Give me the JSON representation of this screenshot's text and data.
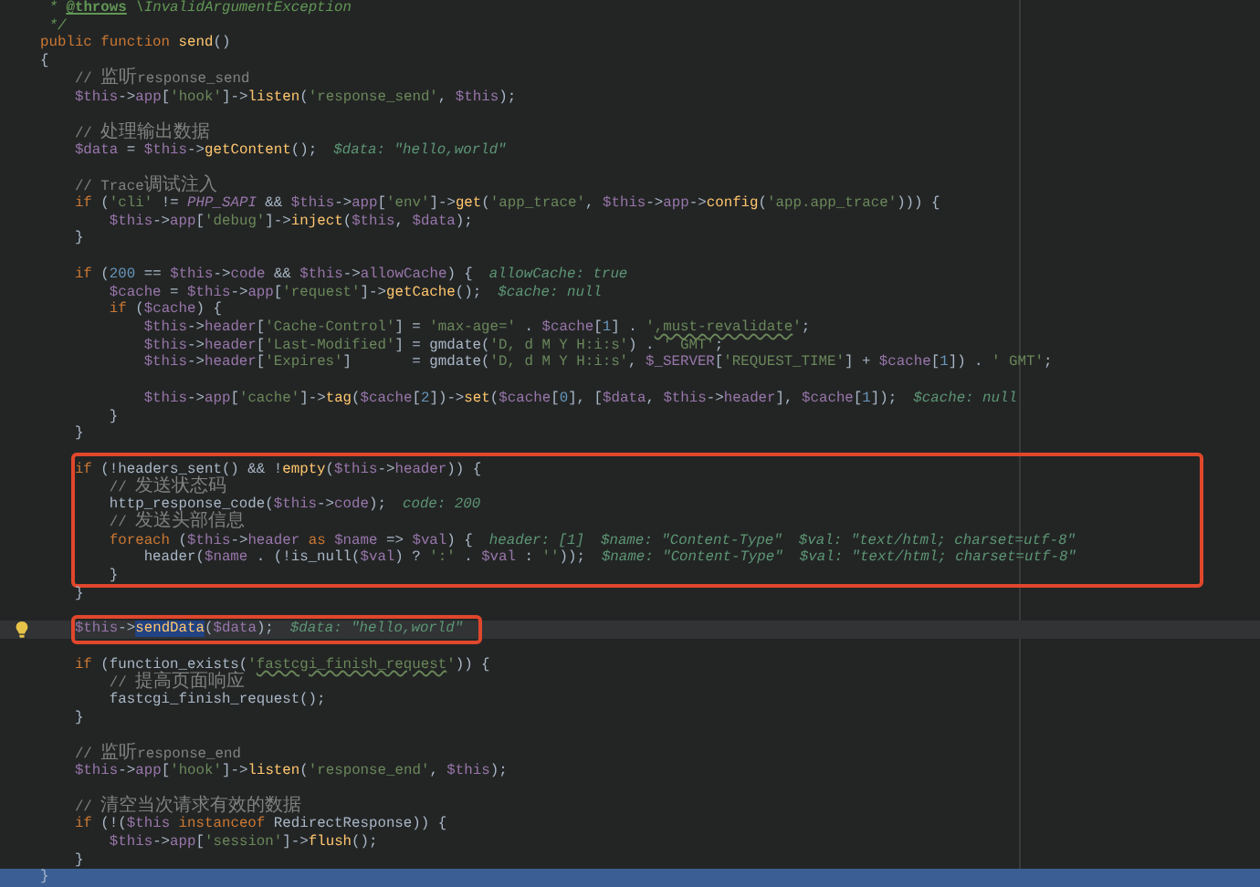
{
  "editor": {
    "segments": [
      {
        "framed": false,
        "current_line": false,
        "selected": false,
        "lines": [
          {
            "kind": "code",
            "tokens": [
              {
                "kind": "doc",
                "text": " * "
              },
              {
                "kind": "doctag",
                "text": "@throws"
              },
              {
                "kind": "doc",
                "text": " \\InvalidArgumentException"
              }
            ]
          },
          {
            "kind": "code",
            "tokens": [
              {
                "kind": "doc",
                "text": " */"
              }
            ]
          },
          {
            "kind": "code",
            "tokens": [
              {
                "kind": "kw",
                "text": "public function "
              },
              {
                "kind": "fn",
                "text": "send"
              },
              {
                "kind": "plain",
                "text": "()"
              }
            ]
          },
          {
            "kind": "code",
            "tokens": [
              {
                "kind": "plain",
                "text": "{"
              }
            ]
          },
          {
            "kind": "code",
            "tokens": [
              {
                "kind": "com",
                "text": "    // "
              },
              {
                "kind": "cjk",
                "text": "监听"
              },
              {
                "kind": "com",
                "text": "response_send"
              }
            ]
          },
          {
            "kind": "code",
            "tokens": [
              {
                "kind": "var",
                "text": "    $this"
              },
              {
                "kind": "plain",
                "text": "->"
              },
              {
                "kind": "var",
                "text": "app"
              },
              {
                "kind": "plain",
                "text": "["
              },
              {
                "kind": "str",
                "text": "'hook'"
              },
              {
                "kind": "plain",
                "text": "]->"
              },
              {
                "kind": "fn",
                "text": "listen"
              },
              {
                "kind": "plain",
                "text": "("
              },
              {
                "kind": "str",
                "text": "'response_send'"
              },
              {
                "kind": "plain",
                "text": ", "
              },
              {
                "kind": "var",
                "text": "$this"
              },
              {
                "kind": "plain",
                "text": ");"
              }
            ]
          },
          {
            "kind": "blank"
          },
          {
            "kind": "code",
            "tokens": [
              {
                "kind": "com",
                "text": "    // "
              },
              {
                "kind": "cjk",
                "text": "处理输出数据"
              }
            ]
          },
          {
            "kind": "code",
            "tokens": [
              {
                "kind": "var",
                "text": "    $data"
              },
              {
                "kind": "plain",
                "text": " = "
              },
              {
                "kind": "var",
                "text": "$this"
              },
              {
                "kind": "plain",
                "text": "->"
              },
              {
                "kind": "fn",
                "text": "getContent"
              },
              {
                "kind": "plain",
                "text": "();"
              }
            ],
            "hints": [
              "$data: \"hello,world\""
            ]
          },
          {
            "kind": "blank"
          },
          {
            "kind": "code",
            "tokens": [
              {
                "kind": "com",
                "text": "    // Trace"
              },
              {
                "kind": "cjk",
                "text": "调试注入"
              }
            ]
          },
          {
            "kind": "code",
            "tokens": [
              {
                "kind": "kw",
                "text": "    if"
              },
              {
                "kind": "plain",
                "text": " ("
              },
              {
                "kind": "str",
                "text": "'cli'"
              },
              {
                "kind": "plain",
                "text": " != "
              },
              {
                "kind": "const",
                "text": "PHP_SAPI"
              },
              {
                "kind": "plain",
                "text": " && "
              },
              {
                "kind": "var",
                "text": "$this"
              },
              {
                "kind": "plain",
                "text": "->"
              },
              {
                "kind": "var",
                "text": "app"
              },
              {
                "kind": "plain",
                "text": "["
              },
              {
                "kind": "str",
                "text": "'env'"
              },
              {
                "kind": "plain",
                "text": "]->"
              },
              {
                "kind": "fn",
                "text": "get"
              },
              {
                "kind": "plain",
                "text": "("
              },
              {
                "kind": "str",
                "text": "'app_trace'"
              },
              {
                "kind": "plain",
                "text": ", "
              },
              {
                "kind": "var",
                "text": "$this"
              },
              {
                "kind": "plain",
                "text": "->"
              },
              {
                "kind": "var",
                "text": "app"
              },
              {
                "kind": "plain",
                "text": "->"
              },
              {
                "kind": "fn",
                "text": "config"
              },
              {
                "kind": "plain",
                "text": "("
              },
              {
                "kind": "str",
                "text": "'app.app_trace'"
              },
              {
                "kind": "plain",
                "text": "))) {"
              }
            ]
          },
          {
            "kind": "code",
            "tokens": [
              {
                "kind": "var",
                "text": "        $this"
              },
              {
                "kind": "plain",
                "text": "->"
              },
              {
                "kind": "var",
                "text": "app"
              },
              {
                "kind": "plain",
                "text": "["
              },
              {
                "kind": "str",
                "text": "'debug'"
              },
              {
                "kind": "plain",
                "text": "]->"
              },
              {
                "kind": "fn",
                "text": "inject"
              },
              {
                "kind": "plain",
                "text": "("
              },
              {
                "kind": "var",
                "text": "$this"
              },
              {
                "kind": "plain",
                "text": ", "
              },
              {
                "kind": "var",
                "text": "$data"
              },
              {
                "kind": "plain",
                "text": ");"
              }
            ]
          },
          {
            "kind": "code",
            "tokens": [
              {
                "kind": "plain",
                "text": "    }"
              }
            ]
          },
          {
            "kind": "blank"
          },
          {
            "kind": "code",
            "tokens": [
              {
                "kind": "kw",
                "text": "    if"
              },
              {
                "kind": "plain",
                "text": " ("
              },
              {
                "kind": "num",
                "text": "200"
              },
              {
                "kind": "plain",
                "text": " == "
              },
              {
                "kind": "var",
                "text": "$this"
              },
              {
                "kind": "plain",
                "text": "->"
              },
              {
                "kind": "var",
                "text": "code"
              },
              {
                "kind": "plain",
                "text": " && "
              },
              {
                "kind": "var",
                "text": "$this"
              },
              {
                "kind": "plain",
                "text": "->"
              },
              {
                "kind": "var",
                "text": "allowCache"
              },
              {
                "kind": "plain",
                "text": ") {"
              }
            ],
            "hints": [
              "allowCache: true"
            ]
          },
          {
            "kind": "code",
            "tokens": [
              {
                "kind": "var",
                "text": "        $cache"
              },
              {
                "kind": "plain",
                "text": " = "
              },
              {
                "kind": "var",
                "text": "$this"
              },
              {
                "kind": "plain",
                "text": "->"
              },
              {
                "kind": "var",
                "text": "app"
              },
              {
                "kind": "plain",
                "text": "["
              },
              {
                "kind": "str",
                "text": "'request'"
              },
              {
                "kind": "plain",
                "text": "]->"
              },
              {
                "kind": "fn",
                "text": "getCache"
              },
              {
                "kind": "plain",
                "text": "();"
              }
            ],
            "hints": [
              "$cache: null"
            ]
          },
          {
            "kind": "code",
            "tokens": [
              {
                "kind": "kw",
                "text": "        if"
              },
              {
                "kind": "plain",
                "text": " ("
              },
              {
                "kind": "var",
                "text": "$cache"
              },
              {
                "kind": "plain",
                "text": ") {"
              }
            ]
          },
          {
            "kind": "code",
            "tokens": [
              {
                "kind": "var",
                "text": "            $this"
              },
              {
                "kind": "plain",
                "text": "->"
              },
              {
                "kind": "var",
                "text": "header"
              },
              {
                "kind": "plain",
                "text": "["
              },
              {
                "kind": "str",
                "text": "'Cache-Control'"
              },
              {
                "kind": "plain",
                "text": "] = "
              },
              {
                "kind": "str",
                "text": "'max-age='"
              },
              {
                "kind": "plain",
                "text": " . "
              },
              {
                "kind": "var",
                "text": "$cache"
              },
              {
                "kind": "plain",
                "text": "["
              },
              {
                "kind": "num",
                "text": "1"
              },
              {
                "kind": "plain",
                "text": "] . "
              },
              {
                "kind": "str",
                "text": "'"
              },
              {
                "kind": "squig",
                "text": ",must-revalidate"
              },
              {
                "kind": "str",
                "text": "'"
              },
              {
                "kind": "plain",
                "text": ";"
              }
            ]
          },
          {
            "kind": "code",
            "tokens": [
              {
                "kind": "var",
                "text": "            $this"
              },
              {
                "kind": "plain",
                "text": "->"
              },
              {
                "kind": "var",
                "text": "header"
              },
              {
                "kind": "plain",
                "text": "["
              },
              {
                "kind": "str",
                "text": "'Last-Modified'"
              },
              {
                "kind": "plain",
                "text": "] = gmdate("
              },
              {
                "kind": "str",
                "text": "'D, d M Y H:i:s'"
              },
              {
                "kind": "plain",
                "text": ") . "
              },
              {
                "kind": "str",
                "text": "' GMT'"
              },
              {
                "kind": "plain",
                "text": ";"
              }
            ]
          },
          {
            "kind": "code",
            "tokens": [
              {
                "kind": "var",
                "text": "            $this"
              },
              {
                "kind": "plain",
                "text": "->"
              },
              {
                "kind": "var",
                "text": "header"
              },
              {
                "kind": "plain",
                "text": "["
              },
              {
                "kind": "str",
                "text": "'Expires'"
              },
              {
                "kind": "plain",
                "text": "]       = gmdate("
              },
              {
                "kind": "str",
                "text": "'D, d M Y H:i:s'"
              },
              {
                "kind": "plain",
                "text": ", "
              },
              {
                "kind": "var",
                "text": "$_SERVER"
              },
              {
                "kind": "plain",
                "text": "["
              },
              {
                "kind": "str",
                "text": "'REQUEST_TIME'"
              },
              {
                "kind": "plain",
                "text": "] + "
              },
              {
                "kind": "var",
                "text": "$cache"
              },
              {
                "kind": "plain",
                "text": "["
              },
              {
                "kind": "num",
                "text": "1"
              },
              {
                "kind": "plain",
                "text": "]) . "
              },
              {
                "kind": "str",
                "text": "' GMT'"
              },
              {
                "kind": "plain",
                "text": ";"
              }
            ]
          },
          {
            "kind": "blank"
          },
          {
            "kind": "code",
            "tokens": [
              {
                "kind": "var",
                "text": "            $this"
              },
              {
                "kind": "plain",
                "text": "->"
              },
              {
                "kind": "var",
                "text": "app"
              },
              {
                "kind": "plain",
                "text": "["
              },
              {
                "kind": "str",
                "text": "'cache'"
              },
              {
                "kind": "plain",
                "text": "]->"
              },
              {
                "kind": "fn",
                "text": "tag"
              },
              {
                "kind": "plain",
                "text": "("
              },
              {
                "kind": "var",
                "text": "$cache"
              },
              {
                "kind": "plain",
                "text": "["
              },
              {
                "kind": "num",
                "text": "2"
              },
              {
                "kind": "plain",
                "text": "])->"
              },
              {
                "kind": "fn",
                "text": "set"
              },
              {
                "kind": "plain",
                "text": "("
              },
              {
                "kind": "var",
                "text": "$cache"
              },
              {
                "kind": "plain",
                "text": "["
              },
              {
                "kind": "num",
                "text": "0"
              },
              {
                "kind": "plain",
                "text": "], ["
              },
              {
                "kind": "var",
                "text": "$data"
              },
              {
                "kind": "plain",
                "text": ", "
              },
              {
                "kind": "var",
                "text": "$this"
              },
              {
                "kind": "plain",
                "text": "->"
              },
              {
                "kind": "var",
                "text": "header"
              },
              {
                "kind": "plain",
                "text": "], "
              },
              {
                "kind": "var",
                "text": "$cache"
              },
              {
                "kind": "plain",
                "text": "["
              },
              {
                "kind": "num",
                "text": "1"
              },
              {
                "kind": "plain",
                "text": "]);"
              }
            ],
            "hints": [
              "$cache: null"
            ]
          },
          {
            "kind": "code",
            "tokens": [
              {
                "kind": "plain",
                "text": "        }"
              }
            ]
          },
          {
            "kind": "code",
            "tokens": [
              {
                "kind": "plain",
                "text": "    }"
              }
            ]
          },
          {
            "kind": "blank"
          }
        ]
      },
      {
        "framed": true,
        "current_line": false,
        "selected": false,
        "lines": [
          {
            "kind": "code",
            "tokens": [
              {
                "kind": "kw",
                "text": "    if"
              },
              {
                "kind": "plain",
                "text": " (!headers_sent() && !"
              },
              {
                "kind": "fn",
                "text": "empty"
              },
              {
                "kind": "plain",
                "text": "("
              },
              {
                "kind": "var",
                "text": "$this"
              },
              {
                "kind": "plain",
                "text": "->"
              },
              {
                "kind": "var",
                "text": "header"
              },
              {
                "kind": "plain",
                "text": ")) {"
              }
            ]
          },
          {
            "kind": "code",
            "tokens": [
              {
                "kind": "com",
                "text": "        // "
              },
              {
                "kind": "cjk",
                "text": "发送状态码"
              }
            ]
          },
          {
            "kind": "code",
            "tokens": [
              {
                "kind": "plain",
                "text": "        http_response_code("
              },
              {
                "kind": "var",
                "text": "$this"
              },
              {
                "kind": "plain",
                "text": "->"
              },
              {
                "kind": "var",
                "text": "code"
              },
              {
                "kind": "plain",
                "text": ");"
              }
            ],
            "hints": [
              "code: 200"
            ]
          },
          {
            "kind": "code",
            "tokens": [
              {
                "kind": "com",
                "text": "        // "
              },
              {
                "kind": "cjk",
                "text": "发送头部信息"
              }
            ]
          },
          {
            "kind": "code",
            "tokens": [
              {
                "kind": "kw",
                "text": "        foreach"
              },
              {
                "kind": "plain",
                "text": " ("
              },
              {
                "kind": "var",
                "text": "$this"
              },
              {
                "kind": "plain",
                "text": "->"
              },
              {
                "kind": "var",
                "text": "header"
              },
              {
                "kind": "kw",
                "text": " as "
              },
              {
                "kind": "var",
                "text": "$name"
              },
              {
                "kind": "plain",
                "text": " => "
              },
              {
                "kind": "var",
                "text": "$val"
              },
              {
                "kind": "plain",
                "text": ") {"
              }
            ],
            "hints": [
              "header: [1]",
              "$name: \"Content-Type\"",
              "$val: \"text/html; charset=utf-8\""
            ]
          },
          {
            "kind": "code",
            "tokens": [
              {
                "kind": "plain",
                "text": "            header("
              },
              {
                "kind": "var",
                "text": "$name"
              },
              {
                "kind": "plain",
                "text": " . (!is_null("
              },
              {
                "kind": "var",
                "text": "$val"
              },
              {
                "kind": "plain",
                "text": ") ? "
              },
              {
                "kind": "str",
                "text": "':'"
              },
              {
                "kind": "plain",
                "text": " . "
              },
              {
                "kind": "var",
                "text": "$val"
              },
              {
                "kind": "plain",
                "text": " : "
              },
              {
                "kind": "str",
                "text": "''"
              },
              {
                "kind": "plain",
                "text": "));"
              }
            ],
            "hints": [
              "$name: \"Content-Type\"",
              "$val: \"text/html; charset=utf-8\""
            ]
          },
          {
            "kind": "code",
            "tokens": [
              {
                "kind": "plain",
                "text": "        }"
              }
            ]
          }
        ]
      },
      {
        "framed": false,
        "current_line": false,
        "selected": false,
        "lines": [
          {
            "kind": "code",
            "tokens": [
              {
                "kind": "plain",
                "text": "    }"
              }
            ]
          },
          {
            "kind": "blank"
          }
        ]
      },
      {
        "framed": true,
        "current_line": true,
        "selected": false,
        "lines": [
          {
            "kind": "code",
            "tokens": [
              {
                "kind": "var",
                "text": "    $this"
              },
              {
                "kind": "plain",
                "text": "->"
              },
              {
                "kind": "sel",
                "text": "sendData"
              },
              {
                "kind": "plain",
                "text": "("
              },
              {
                "kind": "var",
                "text": "$data"
              },
              {
                "kind": "plain",
                "text": ");"
              }
            ],
            "hints": [
              "$data: \"hello,world\""
            ]
          }
        ]
      },
      {
        "framed": false,
        "current_line": false,
        "selected": false,
        "lines": [
          {
            "kind": "blank"
          },
          {
            "kind": "code",
            "tokens": [
              {
                "kind": "kw",
                "text": "    if"
              },
              {
                "kind": "plain",
                "text": " (function_exists("
              },
              {
                "kind": "str",
                "text": "'"
              },
              {
                "kind": "squig",
                "text": "fastcgi_finish_request"
              },
              {
                "kind": "str",
                "text": "'"
              },
              {
                "kind": "plain",
                "text": ")) {"
              }
            ]
          },
          {
            "kind": "code",
            "tokens": [
              {
                "kind": "com",
                "text": "        // "
              },
              {
                "kind": "cjk",
                "text": "提高页面响应"
              }
            ]
          },
          {
            "kind": "code",
            "tokens": [
              {
                "kind": "plain",
                "text": "        fastcgi_finish_request();"
              }
            ]
          },
          {
            "kind": "code",
            "tokens": [
              {
                "kind": "plain",
                "text": "    }"
              }
            ]
          },
          {
            "kind": "blank"
          },
          {
            "kind": "code",
            "tokens": [
              {
                "kind": "com",
                "text": "    // "
              },
              {
                "kind": "cjk",
                "text": "监听"
              },
              {
                "kind": "com",
                "text": "response_end"
              }
            ]
          },
          {
            "kind": "code",
            "tokens": [
              {
                "kind": "var",
                "text": "    $this"
              },
              {
                "kind": "plain",
                "text": "->"
              },
              {
                "kind": "var",
                "text": "app"
              },
              {
                "kind": "plain",
                "text": "["
              },
              {
                "kind": "str",
                "text": "'hook'"
              },
              {
                "kind": "plain",
                "text": "]->"
              },
              {
                "kind": "fn",
                "text": "listen"
              },
              {
                "kind": "plain",
                "text": "("
              },
              {
                "kind": "str",
                "text": "'response_end'"
              },
              {
                "kind": "plain",
                "text": ", "
              },
              {
                "kind": "var",
                "text": "$this"
              },
              {
                "kind": "plain",
                "text": ");"
              }
            ]
          },
          {
            "kind": "blank"
          },
          {
            "kind": "code",
            "tokens": [
              {
                "kind": "com",
                "text": "    // "
              },
              {
                "kind": "cjk",
                "text": "清空当次请求有效的数据"
              }
            ]
          },
          {
            "kind": "code",
            "tokens": [
              {
                "kind": "kw",
                "text": "    if"
              },
              {
                "kind": "plain",
                "text": " (!("
              },
              {
                "kind": "var",
                "text": "$this"
              },
              {
                "kind": "kw",
                "text": " instanceof"
              },
              {
                "kind": "plain",
                "text": " RedirectResponse)) {"
              }
            ]
          },
          {
            "kind": "code",
            "tokens": [
              {
                "kind": "var",
                "text": "        $this"
              },
              {
                "kind": "plain",
                "text": "->"
              },
              {
                "kind": "var",
                "text": "app"
              },
              {
                "kind": "plain",
                "text": "["
              },
              {
                "kind": "str",
                "text": "'session'"
              },
              {
                "kind": "plain",
                "text": "]->"
              },
              {
                "kind": "fn",
                "text": "flush"
              },
              {
                "kind": "plain",
                "text": "();"
              }
            ]
          },
          {
            "kind": "code",
            "tokens": [
              {
                "kind": "plain",
                "text": "    }"
              }
            ]
          }
        ]
      },
      {
        "framed": false,
        "current_line": false,
        "selected": true,
        "lines": [
          {
            "kind": "code",
            "tokens": [
              {
                "kind": "plain",
                "text": "}"
              }
            ]
          }
        ]
      }
    ]
  }
}
